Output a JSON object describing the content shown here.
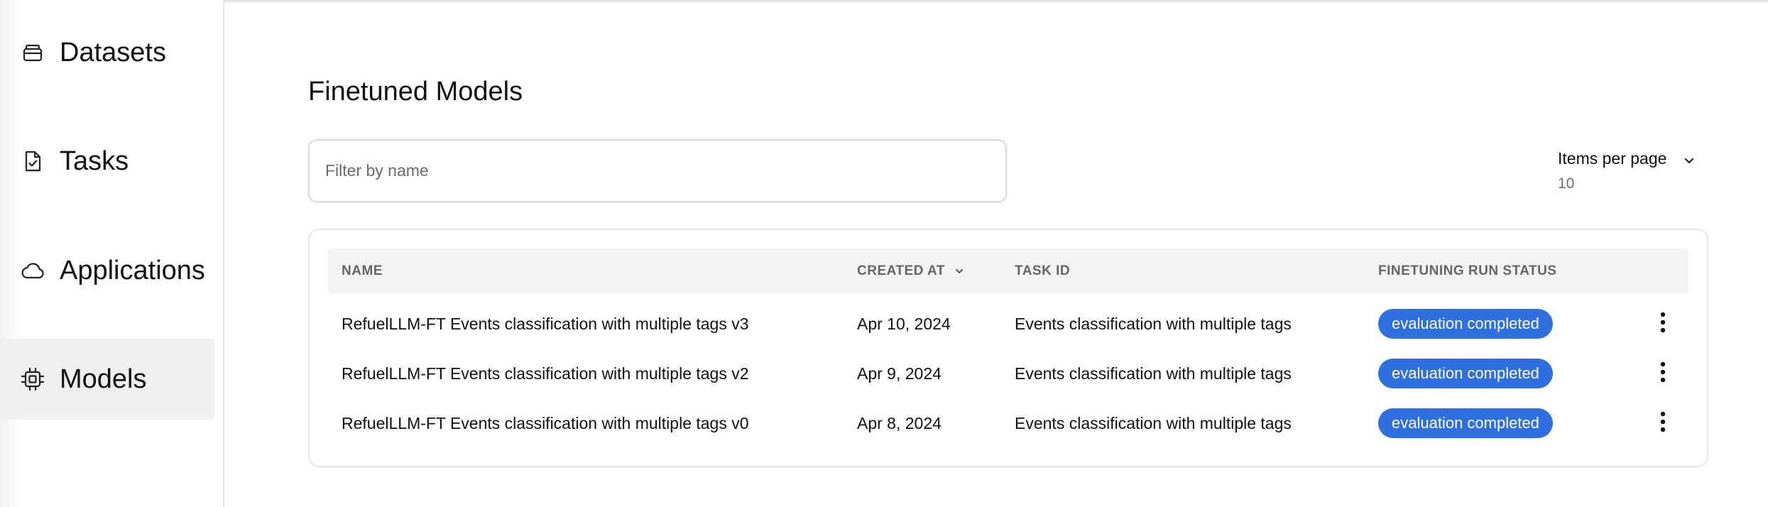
{
  "sidebar": {
    "items": [
      {
        "label": "Datasets",
        "icon": "database-icon"
      },
      {
        "label": "Tasks",
        "icon": "task-file-icon"
      },
      {
        "label": "Applications",
        "icon": "cloud-icon"
      },
      {
        "label": "Models",
        "icon": "chip-icon",
        "active": true
      }
    ]
  },
  "page": {
    "title": "Finetuned Models"
  },
  "filter": {
    "placeholder": "Filter by name",
    "value": ""
  },
  "pagination": {
    "items_per_page_label": "Items per page",
    "items_per_page_value": "10"
  },
  "table": {
    "columns": [
      "NAME",
      "CREATED AT",
      "TASK ID",
      "FINETUNING RUN STATUS"
    ],
    "sorted_column": "CREATED AT",
    "rows": [
      {
        "name": "RefuelLLM-FT Events classification with multiple tags v3",
        "created_at": "Apr 10, 2024",
        "task_id": "Events classification with multiple tags",
        "status": "evaluation completed"
      },
      {
        "name": "RefuelLLM-FT Events classification with multiple tags v2",
        "created_at": "Apr 9, 2024",
        "task_id": "Events classification with multiple tags",
        "status": "evaluation completed"
      },
      {
        "name": "RefuelLLM-FT Events classification with multiple tags v0",
        "created_at": "Apr 8, 2024",
        "task_id": "Events classification with multiple tags",
        "status": "evaluation completed"
      }
    ]
  },
  "colors": {
    "status_badge": "#2f6fe0",
    "active_nav_bg": "#efefef",
    "header_bg": "#f3f3f3"
  }
}
